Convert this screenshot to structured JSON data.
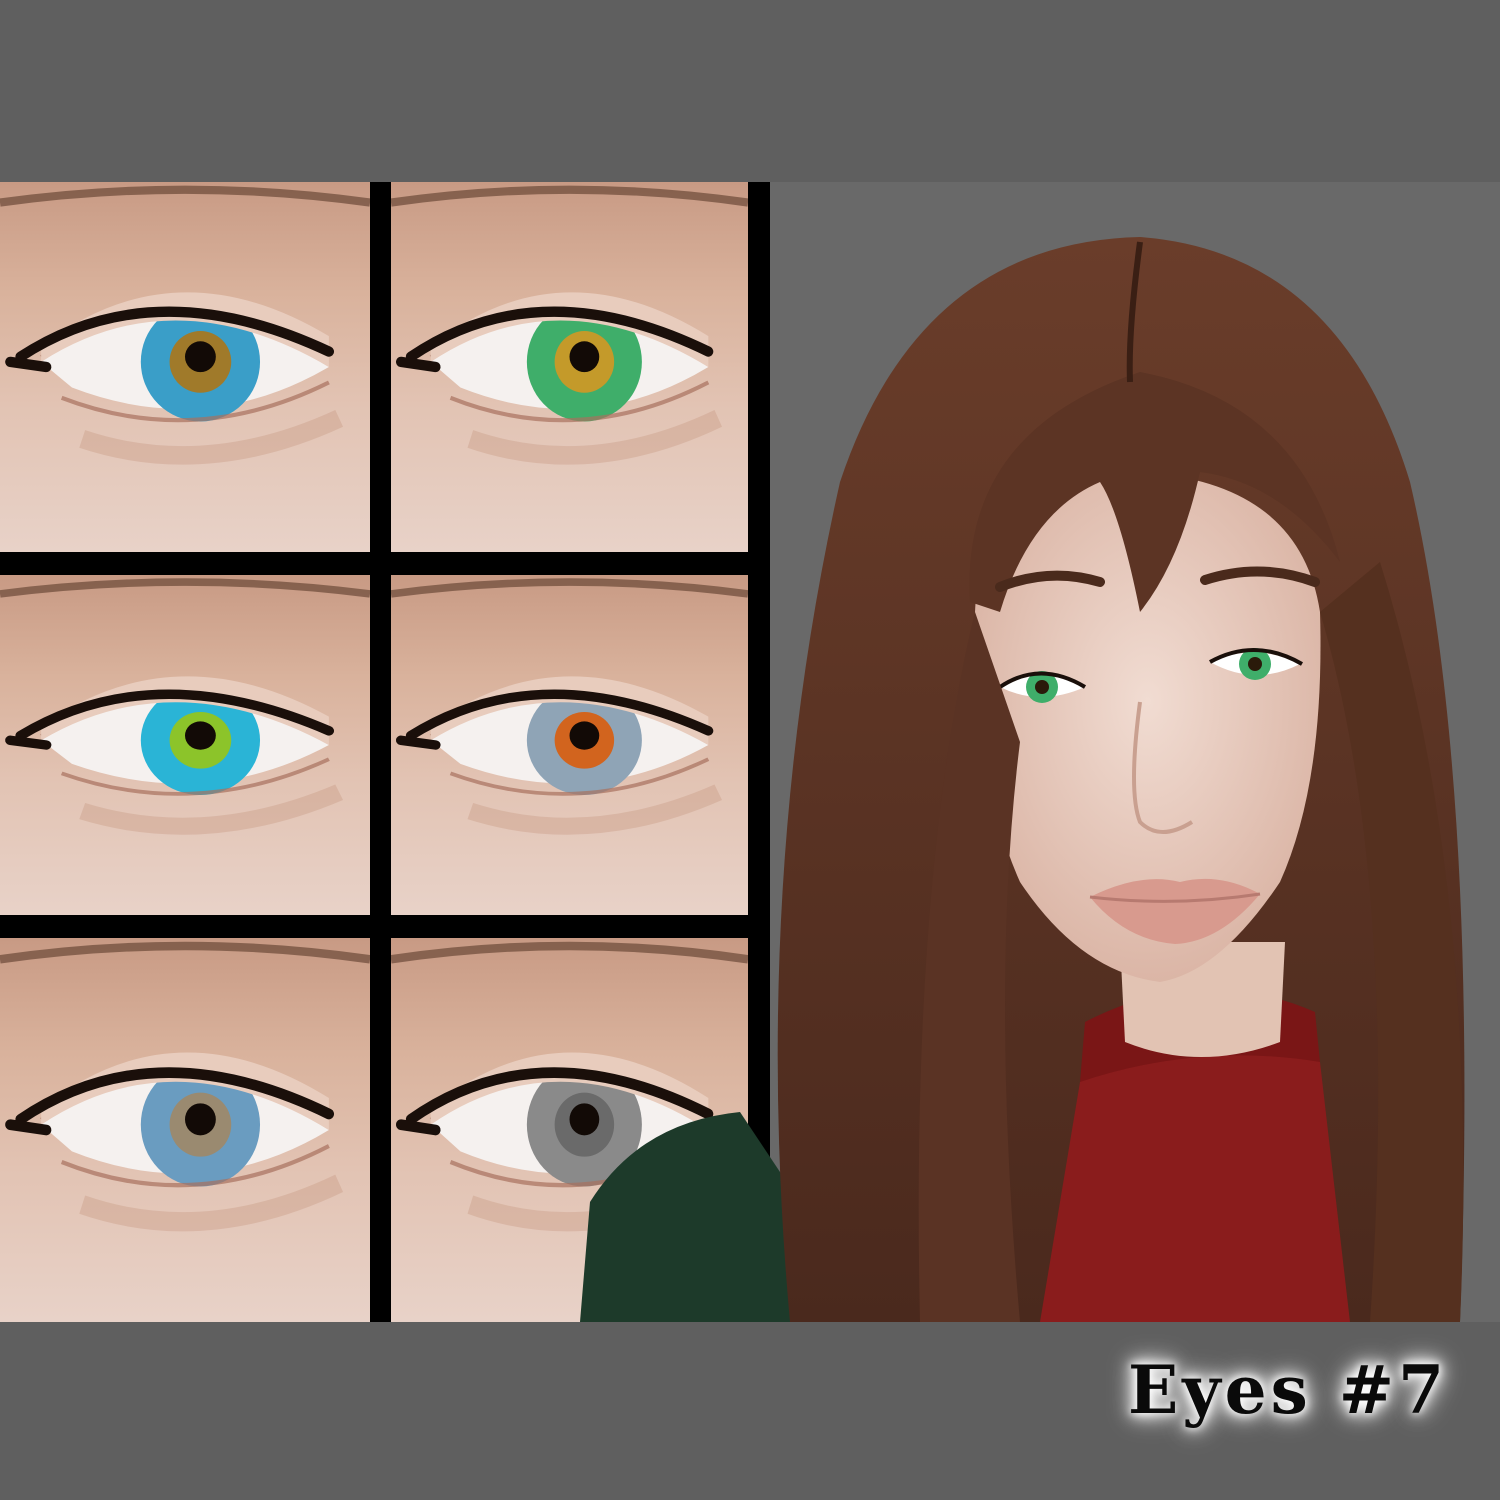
{
  "title": "Eyes #7",
  "swatches": [
    {
      "name": "blue-amber",
      "outer": "#3a9ec8",
      "inner": "#a07a2a"
    },
    {
      "name": "green-amber",
      "outer": "#3fae6a",
      "inner": "#c49a2a"
    },
    {
      "name": "aqua-green",
      "outer": "#2ab4d6",
      "inner": "#8cc42a"
    },
    {
      "name": "grey-orange",
      "outer": "#8fa4b6",
      "inner": "#d2641e"
    },
    {
      "name": "blue-grey",
      "outer": "#6a9cc0",
      "inner": "#9a8a70"
    },
    {
      "name": "grey",
      "outer": "#8a8a8a",
      "inner": "#6a6a6a"
    }
  ],
  "colors": {
    "background": "#5f5f5f",
    "panel": "#696969",
    "hair": "#5a3324",
    "sweater": "#8a1c1c",
    "jacket": "#1d3a2a"
  }
}
